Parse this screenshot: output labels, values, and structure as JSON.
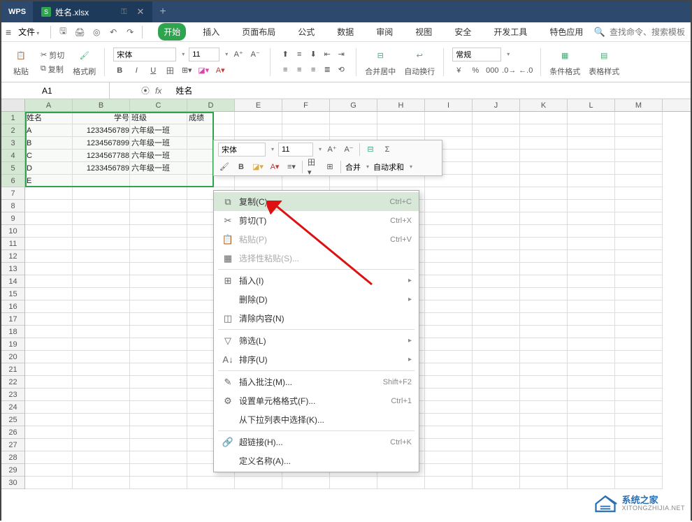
{
  "title_bar": {
    "logo": "WPS",
    "filename": "姓名.xlsx",
    "key_hint": "⌕",
    "add": "+"
  },
  "menu": {
    "file": "文件",
    "tabs": [
      "开始",
      "插入",
      "页面布局",
      "公式",
      "数据",
      "审阅",
      "视图",
      "安全",
      "开发工具",
      "特色应用"
    ],
    "search_placeholder": "查找命令、搜索模板"
  },
  "ribbon": {
    "paste": "粘贴",
    "cut": "剪切",
    "copy": "复制",
    "format_painter": "格式刷",
    "font_name": "宋体",
    "font_size": "11",
    "merge_center": "合并居中",
    "wrap": "自动换行",
    "number_format": "常规",
    "cond_format": "条件格式",
    "table_style": "表格样式"
  },
  "formula_bar": {
    "name_box": "A1",
    "fx": "fx",
    "value": "姓名"
  },
  "columns": [
    "A",
    "B",
    "C",
    "D",
    "E",
    "F",
    "G",
    "H",
    "I",
    "J",
    "K",
    "L",
    "M"
  ],
  "rows_count": 30,
  "table": {
    "headers": [
      "姓名",
      "学号",
      "班级",
      "成绩"
    ],
    "rows": [
      [
        "A",
        "1233456789",
        "六年级一班",
        ""
      ],
      [
        "B",
        "1234567899",
        "六年级一班",
        ""
      ],
      [
        "C",
        "1234567788",
        "六年级一班",
        ""
      ],
      [
        "D",
        "1233456789",
        "六年级一班",
        ""
      ],
      [
        "E",
        "",
        "",
        ""
      ]
    ]
  },
  "mini_toolbar": {
    "font_name": "宋体",
    "font_size": "11",
    "merge": "合并",
    "autosum": "自动求和"
  },
  "context_menu": {
    "items": [
      {
        "icon": "⧉",
        "label": "复制(C)",
        "shortcut": "Ctrl+C",
        "hl": true
      },
      {
        "icon": "✂",
        "label": "剪切(T)",
        "shortcut": "Ctrl+X"
      },
      {
        "icon": "📋",
        "label": "粘贴(P)",
        "shortcut": "Ctrl+V",
        "disabled": true
      },
      {
        "icon": "▦",
        "label": "选择性粘贴(S)...",
        "disabled": true
      },
      {
        "sep": true
      },
      {
        "icon": "⊞",
        "label": "插入(I)",
        "sub": true
      },
      {
        "icon": "",
        "label": "删除(D)",
        "sub": true
      },
      {
        "icon": "◫",
        "label": "清除内容(N)"
      },
      {
        "sep": true
      },
      {
        "icon": "▽",
        "label": "筛选(L)",
        "sub": true
      },
      {
        "icon": "A↓",
        "label": "排序(U)",
        "sub": true
      },
      {
        "sep": true
      },
      {
        "icon": "✎",
        "label": "插入批注(M)...",
        "shortcut": "Shift+F2"
      },
      {
        "icon": "⚙",
        "label": "设置单元格格式(F)...",
        "shortcut": "Ctrl+1"
      },
      {
        "icon": "",
        "label": "从下拉列表中选择(K)..."
      },
      {
        "sep": true
      },
      {
        "icon": "🔗",
        "label": "超链接(H)...",
        "shortcut": "Ctrl+K"
      },
      {
        "icon": "",
        "label": "定义名称(A)..."
      }
    ]
  },
  "watermark": {
    "title": "系统之家",
    "sub": "XITONGZHIJIA.NET"
  }
}
